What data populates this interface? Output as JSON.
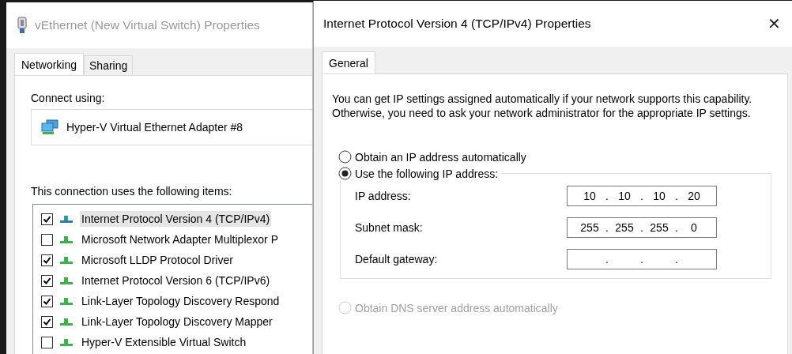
{
  "adapter_window": {
    "title": "vEthernet (New Virtual Switch) Properties",
    "active": false,
    "tabs": [
      {
        "label": "Networking",
        "selected": true
      },
      {
        "label": "Sharing",
        "selected": false
      }
    ],
    "connect_using_label": "Connect using:",
    "adapter_name": "Hyper-V Virtual Ethernet Adapter #8",
    "items_label": "This connection uses the following items:",
    "items": [
      {
        "label": "Internet Protocol Version 4 (TCP/IPv4)",
        "checked": true,
        "selected": true
      },
      {
        "label": "Microsoft Network Adapter Multiplexor P",
        "checked": false,
        "selected": false
      },
      {
        "label": "Microsoft LLDP Protocol Driver",
        "checked": true,
        "selected": false
      },
      {
        "label": "Internet Protocol Version 6 (TCP/IPv6)",
        "checked": true,
        "selected": false
      },
      {
        "label": "Link-Layer Topology Discovery Respond",
        "checked": true,
        "selected": false
      },
      {
        "label": "Link-Layer Topology Discovery Mapper",
        "checked": true,
        "selected": false
      },
      {
        "label": "Hyper-V Extensible Virtual Switch",
        "checked": false,
        "selected": false
      }
    ]
  },
  "ipv4_window": {
    "title": "Internet Protocol Version 4 (TCP/IPv4) Properties",
    "close": "✕",
    "tabs": [
      {
        "label": "General",
        "selected": true
      }
    ],
    "description": "You can get IP settings assigned automatically if your network supports this capability. Otherwise, you need to ask your network administrator for the appropriate IP settings.",
    "ip_options": [
      {
        "label": "Obtain an IP address automatically",
        "selected": false,
        "disabled": false
      },
      {
        "label": "Use the following IP address:",
        "selected": true,
        "disabled": false
      }
    ],
    "fields": [
      {
        "label": "IP address:",
        "octets": [
          "10",
          "10",
          "10",
          "20"
        ],
        "separators": [
          ".",
          ".",
          "."
        ]
      },
      {
        "label": "Subnet mask:",
        "octets": [
          "255",
          "255",
          "255",
          "0"
        ],
        "separators": [
          ".",
          ".",
          "."
        ]
      },
      {
        "label": "Default gateway:",
        "separators": [
          ".",
          ".",
          "."
        ]
      }
    ],
    "dns_option": {
      "label": "Obtain DNS server address automatically",
      "selected": false,
      "disabled": true
    }
  }
}
